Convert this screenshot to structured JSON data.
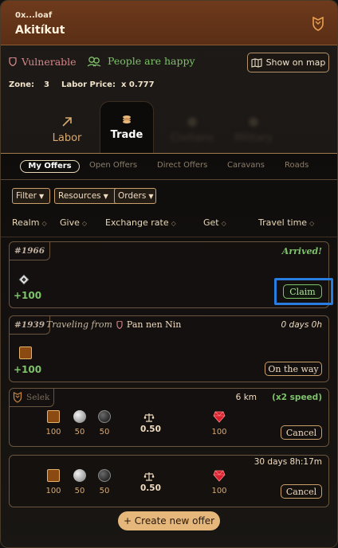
{
  "header": {
    "subtitle": "0x...loaf",
    "title": "Akitíkut"
  },
  "status": {
    "vulnerable": "Vulnerable",
    "happiness": "People are happy",
    "show_map": "Show on map"
  },
  "info": {
    "zone_label": "Zone:",
    "zone_value": "3",
    "labor_price_label": "Labor Price:",
    "labor_price_value": "x 0.777"
  },
  "tabs": [
    {
      "label": "Labor",
      "icon": "arrow-up-right-icon"
    },
    {
      "label": "Trade",
      "icon": "coins-icon"
    },
    {
      "label": "Civilians",
      "icon": "blurred-icon"
    },
    {
      "label": "Military",
      "icon": "blurred-icon"
    }
  ],
  "subtabs": [
    "My Offers",
    "Open Offers",
    "Direct Offers",
    "Caravans",
    "Roads"
  ],
  "filters": [
    "Filter",
    "Resources",
    "Orders"
  ],
  "columns": [
    "Realm",
    "Give",
    "Exchange rate",
    "Get",
    "Travel time"
  ],
  "offers": [
    {
      "id": "#1966",
      "status": "Arrived!",
      "amount": "+100",
      "action": "Claim"
    },
    {
      "id": "#1939",
      "traveling_label": "Traveling from",
      "origin": "Pan nen Nin",
      "time": "0 days 0h",
      "amount": "+100",
      "action": "On the way"
    }
  ],
  "orders": [
    {
      "realm": "Selek",
      "distance": "6 km",
      "speed": "(x2 speed)",
      "give": [
        "100",
        "50",
        "50"
      ],
      "rate": "0.50",
      "get": "100",
      "action": "Cancel"
    },
    {
      "time": "30 days 8h:17m",
      "give": [
        "100",
        "50",
        "50"
      ],
      "rate": "0.50",
      "get": "100",
      "action": "Cancel"
    }
  ],
  "create_button": "+ Create new offer",
  "colors": {
    "header_bg": "#6e3a1c",
    "accent": "#c9a06a",
    "positive": "#7ec26a",
    "danger": "#d4868a",
    "highlight": "#2a7de0"
  }
}
